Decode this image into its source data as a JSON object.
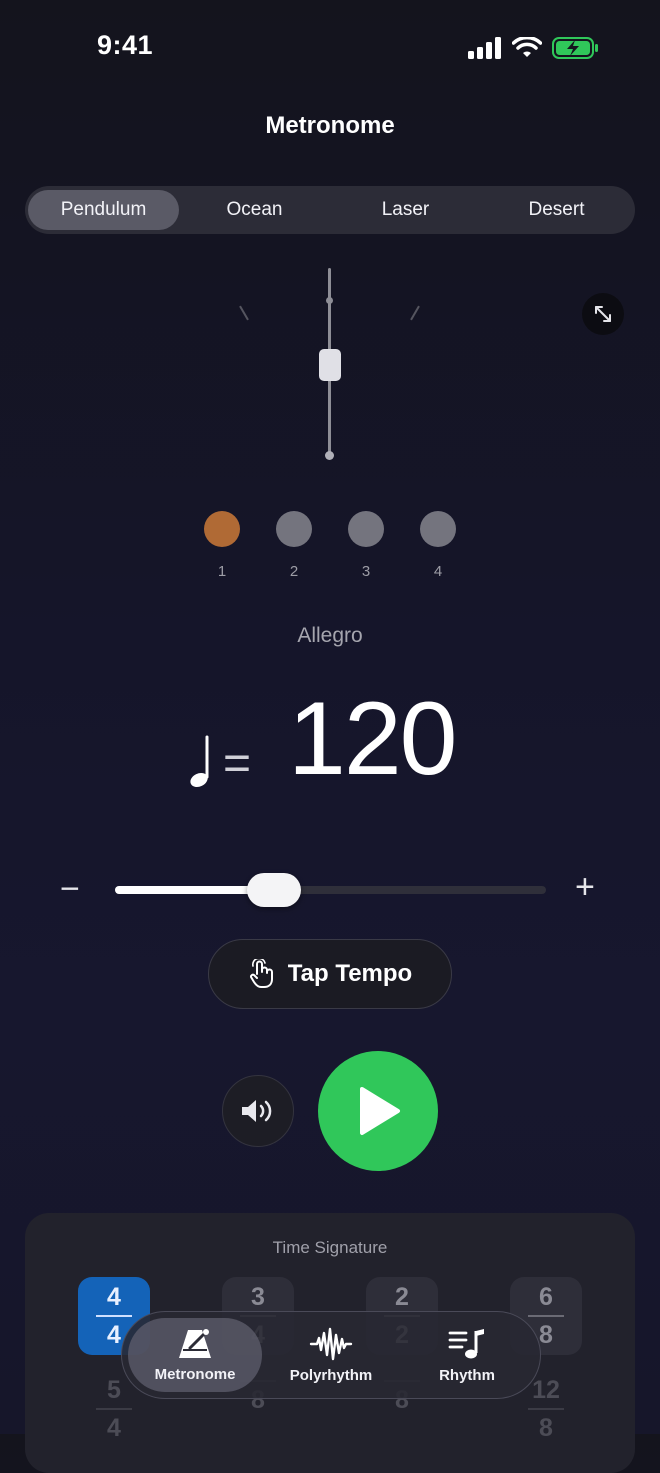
{
  "status_bar": {
    "time": "9:41"
  },
  "header": {
    "title": "Metronome"
  },
  "segments": [
    {
      "label": "Pendulum",
      "active": true
    },
    {
      "label": "Ocean",
      "active": false
    },
    {
      "label": "Laser",
      "active": false
    },
    {
      "label": "Desert",
      "active": false
    }
  ],
  "beats": [
    "1",
    "2",
    "3",
    "4"
  ],
  "active_beat": 1,
  "tempo": {
    "name": "Allegro",
    "bpm": "120",
    "equals": "=",
    "slider_fraction": 0.37
  },
  "slider": {
    "minus": "−",
    "plus": "+"
  },
  "tap_tempo": {
    "label": "Tap Tempo"
  },
  "time_signature": {
    "label": "Time Signature",
    "options": [
      {
        "top": "4",
        "bottom": "4",
        "selected": true
      },
      {
        "top": "3",
        "bottom": "4",
        "selected": false
      },
      {
        "top": "2",
        "bottom": "2",
        "selected": false
      },
      {
        "top": "6",
        "bottom": "8",
        "selected": false
      }
    ],
    "row2": [
      {
        "top": "5",
        "bottom": "4"
      },
      {
        "top": "",
        "bottom": "8"
      },
      {
        "top": "",
        "bottom": "8"
      },
      {
        "top": "12",
        "bottom": "8"
      }
    ]
  },
  "tabbar": [
    {
      "label": "Metronome",
      "icon": "metronome-icon",
      "active": true
    },
    {
      "label": "Polyrhythm",
      "icon": "waveform-icon",
      "active": false
    },
    {
      "label": "Rhythm",
      "icon": "music-list-icon",
      "active": false
    }
  ],
  "colors": {
    "accent_beat": "#b06a35",
    "play": "#30c75a",
    "selected_ts": "#1463b8"
  }
}
